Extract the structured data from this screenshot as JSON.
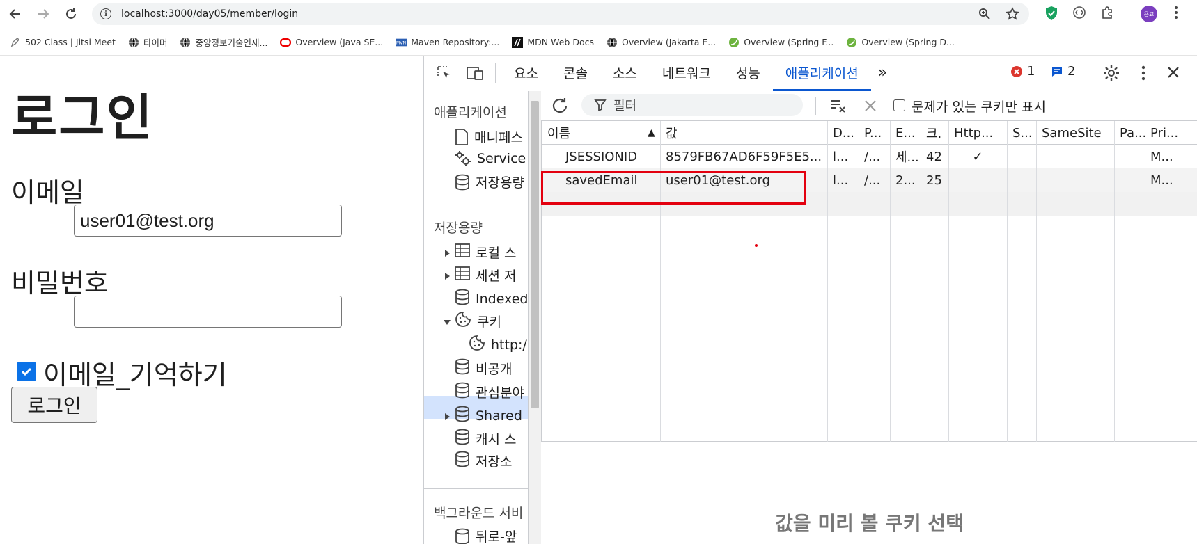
{
  "browser": {
    "url": "localhost:3000/day05/member/login",
    "bookmarks": [
      {
        "label": "502 Class | Jitsi Meet",
        "icon": "pen-icon"
      },
      {
        "label": "타이머",
        "icon": "globe-icon"
      },
      {
        "label": "중앙정보기술인재...",
        "icon": "globe-icon"
      },
      {
        "label": "Overview (Java SE...",
        "icon": "oracle-icon"
      },
      {
        "label": "Maven Repository:...",
        "icon": "maven-icon"
      },
      {
        "label": "MDN Web Docs",
        "icon": "mdn-icon"
      },
      {
        "label": "Overview (Jakarta E...",
        "icon": "globe-icon"
      },
      {
        "label": "Overview (Spring F...",
        "icon": "spring-icon"
      },
      {
        "label": "Overview (Spring D...",
        "icon": "spring-icon"
      }
    ],
    "profile_initials": "용교"
  },
  "page": {
    "title": "로그인",
    "email_label": "이메일",
    "email_value": "user01@test.org",
    "password_label": "비밀번호",
    "password_value": "",
    "remember_label": "이메일_기억하기",
    "remember_checked": true,
    "login_button": "로그인"
  },
  "devtools": {
    "tabs": [
      "요소",
      "콘솔",
      "소스",
      "네트워크",
      "성능",
      "애플리케이션"
    ],
    "active_tab": "애플리케이션",
    "more_tabs": "»",
    "errors": "1",
    "messages": "2",
    "sidebar": {
      "app_header": "애플리케이션",
      "app_items": [
        "매니페스",
        "Service",
        "저장용량"
      ],
      "storage_header": "저장용량",
      "storage_items": [
        "로컬 스",
        "세션 저",
        "Indexed",
        "쿠키",
        "http:/",
        "비공개",
        "관심분야",
        "Shared",
        "캐시 스",
        "저장소"
      ],
      "bg_header": "백그라운드 서비",
      "bg_items": [
        "뒤로-앞"
      ]
    },
    "filter_placeholder": "필터",
    "only_issues_label": "문제가 있는 쿠키만 표시",
    "columns": [
      "이름",
      "값",
      "D...",
      "P...",
      "E...",
      "크.",
      "Http...",
      "S...",
      "SameSite",
      "Pa...",
      "Pri..."
    ],
    "sort_indicator": "▲",
    "cookies": [
      {
        "name": "JSESSIONID",
        "value": "8579FB67AD6F59F5E5...",
        "domain": "l...",
        "path": "/...",
        "expires": "세...",
        "size": "42",
        "http": "✓",
        "secure": "",
        "samesite": "",
        "partition": "",
        "priority": "M..."
      },
      {
        "name": "savedEmail",
        "value": "user01@test.org",
        "domain": "l...",
        "path": "/...",
        "expires": "2...",
        "size": "25",
        "http": "",
        "secure": "",
        "samesite": "",
        "partition": "",
        "priority": "M..."
      }
    ],
    "preview_message": "값을 미리 볼 쿠키 선택"
  }
}
